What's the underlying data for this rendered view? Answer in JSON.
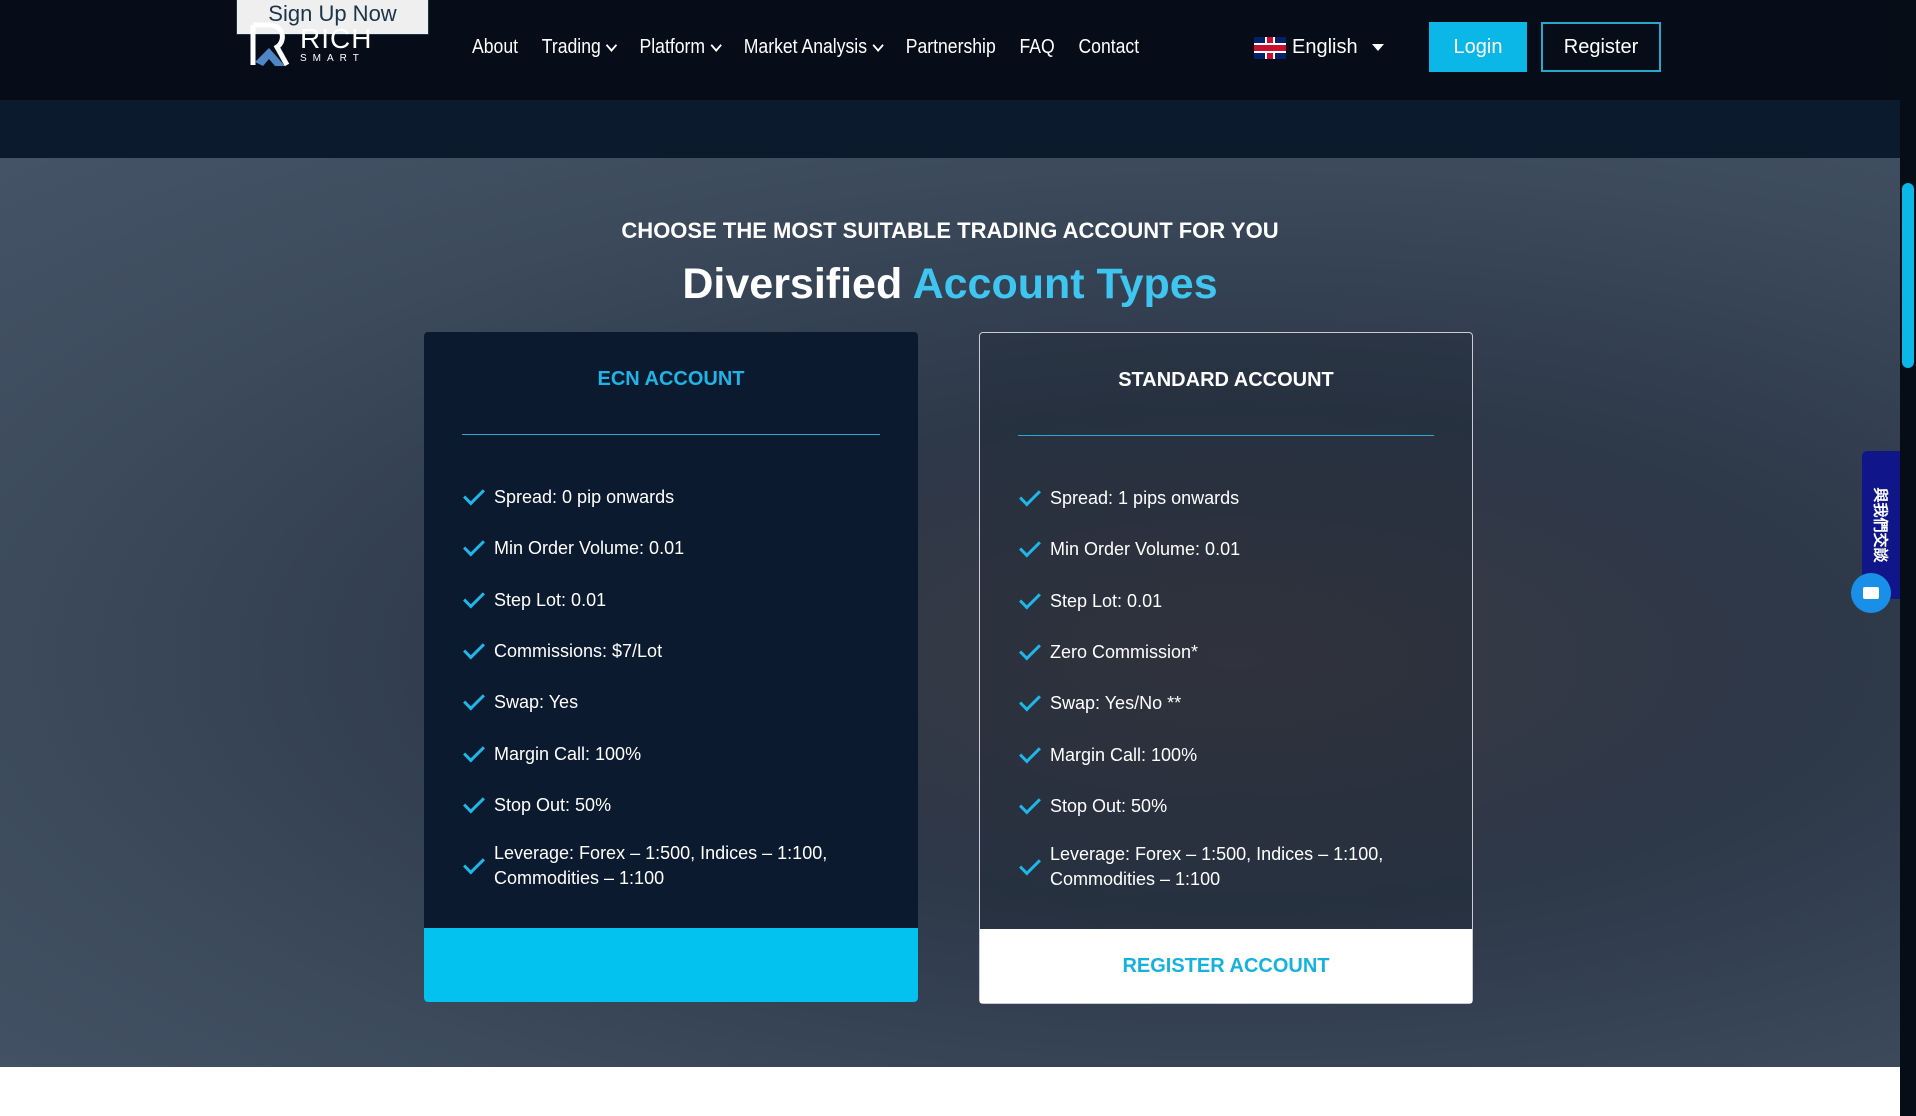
{
  "header": {
    "ghost_button": "Sign Up Now",
    "logo": {
      "name": "RICH",
      "sub": "SMART"
    },
    "nav": [
      {
        "label": "About"
      },
      {
        "label": "Trading",
        "dropdown": true
      },
      {
        "label": "Platform",
        "dropdown": true
      },
      {
        "label": "Market Analysis",
        "dropdown": true
      },
      {
        "label": "Partnership"
      },
      {
        "label": "FAQ"
      },
      {
        "label": "Contact"
      }
    ],
    "language": "English",
    "login": "Login",
    "register": "Register"
  },
  "section": {
    "eyebrow": "CHOOSE THE MOST SUITABLE TRADING ACCOUNT FOR YOU",
    "title_a": "Diversified",
    "title_b": "Account Types",
    "cards": [
      {
        "title": "ECN ACCOUNT",
        "title_color": "#20b4e6",
        "items": [
          "Spread: 0 pip onwards",
          "Min Order Volume: 0.01",
          "Step Lot: 0.01",
          "Commissions: $7/Lot",
          "Swap: Yes",
          "Margin Call: 100%",
          "Stop Out: 50%",
          "Leverage: Forex – 1:500, Indices – 1:100, Commodities – 1:100"
        ],
        "cta": ""
      },
      {
        "title": "STANDARD ACCOUNT",
        "title_color": "#ffffff",
        "items": [
          "Spread: 1 pips onwards",
          "Min Order Volume: 0.01",
          "Step Lot: 0.01",
          "Zero Commission*",
          "Swap: Yes/No **",
          "Margin Call: 100%",
          "Stop Out: 50%",
          "Leverage: Forex – 1:500, Indices – 1:100, Commodities – 1:100"
        ],
        "cta": "REGISTER ACCOUNT"
      }
    ]
  },
  "widget": {
    "label": "與我們交談",
    "icon": "chat-icon"
  },
  "colors": {
    "accent": "#0bb7e6",
    "header_bg": "#060d18"
  }
}
